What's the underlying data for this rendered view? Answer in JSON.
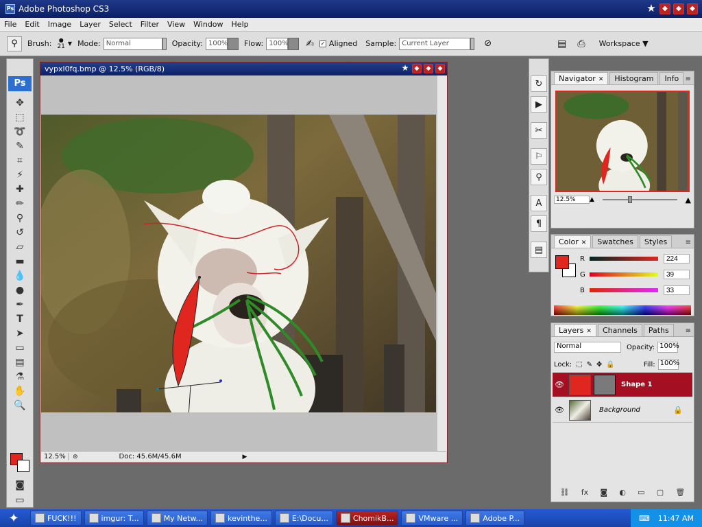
{
  "app": {
    "title": "Adobe Photoshop CS3",
    "icon": "Ps"
  },
  "menu": [
    "File",
    "Edit",
    "Image",
    "Layer",
    "Select",
    "Filter",
    "View",
    "Window",
    "Help"
  ],
  "options": {
    "brush_label": "Brush:",
    "brush_size": "21",
    "mode_label": "Mode:",
    "mode_value": "Normal",
    "opacity_label": "Opacity:",
    "opacity_value": "100%",
    "flow_label": "Flow:",
    "flow_value": "100%",
    "aligned_label": "Aligned",
    "sample_label": "Sample:",
    "sample_value": "Current Layer",
    "workspace_label": "Workspace ▼"
  },
  "document": {
    "title": "vypxl0fq.bmp @ 12.5% (RGB/8)",
    "zoom": "12.5%",
    "doc_info": "Doc: 45.6M/45.6M"
  },
  "navigator": {
    "tabs": [
      "Navigator",
      "Histogram",
      "Info"
    ],
    "zoom": "12.5%",
    "view_box_color": "#e0271f"
  },
  "color_panel": {
    "tabs": [
      "Color",
      "Swatches",
      "Styles"
    ],
    "r_label": "R",
    "r_value": "224",
    "g_label": "G",
    "g_value": "39",
    "b_label": "B",
    "b_value": "33",
    "foreground": "#e0271f"
  },
  "layers_panel": {
    "tabs": [
      "Layers",
      "Channels",
      "Paths"
    ],
    "blend_mode": "Normal",
    "opacity_label": "Opacity:",
    "opacity_value": "100%",
    "lock_label": "Lock:",
    "fill_label": "Fill:",
    "fill_value": "100%",
    "layers": [
      {
        "name": "Shape 1",
        "selected": true
      },
      {
        "name": "Background",
        "selected": false
      }
    ]
  },
  "taskbar": {
    "tasks": [
      "FUCK!!!",
      "imgur: T...",
      "My Netw...",
      "kevinthe...",
      "E:\\Docu...",
      "ChomikB...",
      "VMware ...",
      "Adobe P..."
    ],
    "clock": "11:47 AM"
  },
  "colors": {
    "accent": "#a50f22",
    "brush_red": "#e0271f"
  }
}
